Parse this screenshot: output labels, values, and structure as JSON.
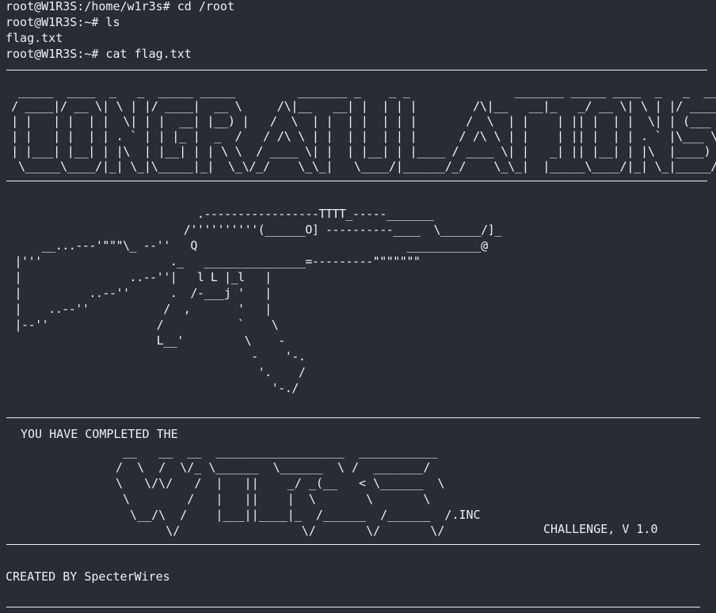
{
  "terminal": {
    "lines": [
      "root@W1R3S:/home/w1r3s# cd /root",
      "root@W1R3S:~# ls",
      "flag.txt",
      "root@W1R3S:~# cat flag.txt"
    ]
  },
  "flag": {
    "congratulations_art": " _____  ____  _   _  _____ _____         _______ _    _ _               _______ _____ ____  _   _  _____ \n/ ____|/ __ \\| \\ | |/ ____|  __ \\     /\\|__   __| |  | | |        /\\|__   __|_   _/ __ \\| \\ | |/ ____|\n| |   | |  | |  \\| | |  __| |__) |   /  \\  | |  | |  | | |       /  \\  | |    | || |  | |  \\| | (___  \n| |   | |  | | . ` | | |_ |  _  /   / /\\ \\ | |  | |  | | |      / /\\ \\ | |    | || |  | | . ` |\\___ \\ \n| |___| |__| | |\\  | |__| | | \\ \\  / ____ \\| |  | |__| | |____ / ____ \\| |   _| || |__| | |\\  |____) |\n \\_____\\____/|_| \\_|\\_____|_|  \\_\\/_/    \\_\\_|   \\____/|______/_/    \\_\\_|  |_____\\____/|_| \\_|_____/ ",
    "gun_art": "                            .-----------------TTTT_-----_______\n                          /''''''''''(______O] ----------____  \\______/]_\n     __...---'\"\"\"\\_ --''   Q                               ___________@\n |'''                   ._   _______________=---------\"\"\"\"\"\"\"\n |                ..--''|   l L |_l   |\n |          ..--''      .  /-___j '   |\n |    ..--''           /  ,       '   |\n |--''                /           `    \\\n                      L__'         \\    -\n                                    -    '-.\n                                     '.    /\n                                       '-./",
    "completed_text": "YOU HAVE COMPLETED THE",
    "wires_art": " __   __  __  __________________  ___________\n/  \\  /  \\/_ \\______  \\______  \\ /  _______/\n\\   \\/\\/   /  |   ||    _/ _(__   < \\______  \\\n \\        /   |   ||    |  \\       \\       \\\n  \\__/\\  /    |___||____|_  /______  /______  /.INC\n       \\/                 \\/       \\/       \\/",
    "inc_text": ".INC",
    "challenge_text": "CHALLENGE, V 1.0",
    "created_by": "CREATED BY SpecterWires"
  }
}
